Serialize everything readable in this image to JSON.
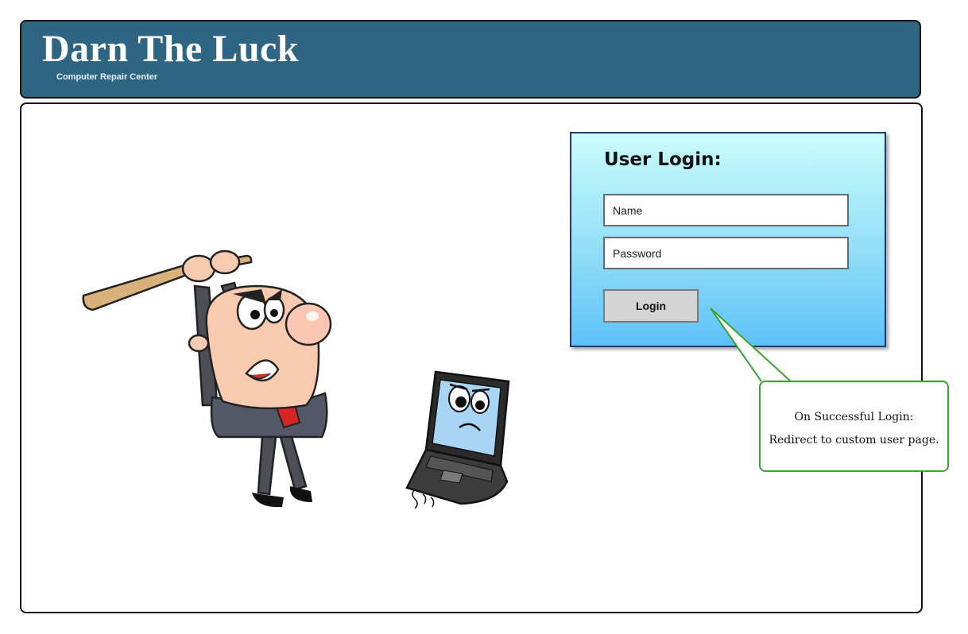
{
  "header": {
    "title": "Darn The Luck",
    "subtitle": "Computer Repair Center"
  },
  "login": {
    "title": "User Login:",
    "name_placeholder": "Name",
    "password_placeholder": "Password",
    "button_label": "Login"
  },
  "callout": {
    "line1": "On Successful Login:",
    "line2": "Redirect to custom user page."
  },
  "illustrations": {
    "left": "angry-businessman-with-bat-icon",
    "right": "scared-laptop-icon"
  },
  "colors": {
    "header_bg": "#2d6583",
    "login_gradient_top": "#cafcfd",
    "login_gradient_bottom": "#5dc2f9",
    "callout_border": "#3aa42f"
  }
}
